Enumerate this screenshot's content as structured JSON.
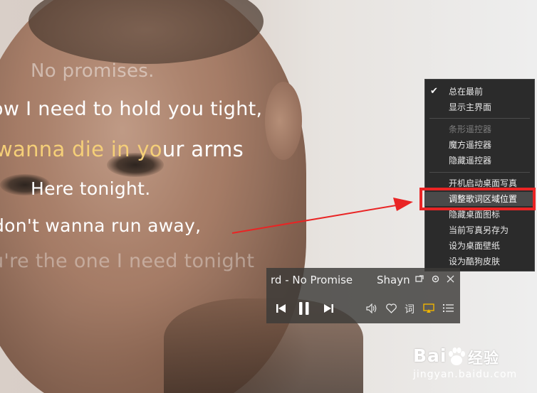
{
  "lyrics": {
    "line1": "No promises.",
    "line2": "ow I need to hold you tight,",
    "line3_sung": "wanna die in yo",
    "line3_rest": "ur arms",
    "line4": "Here tonight.",
    "line5": "don't wanna run away,",
    "line6": "u're the one I need tonight"
  },
  "menu": {
    "items": [
      {
        "label": "总在最前",
        "checked": true
      },
      {
        "label": "显示主界面"
      },
      {
        "label": "条形遥控器",
        "disabled": true
      },
      {
        "label": "魔方遥控器"
      },
      {
        "label": "隐藏遥控器"
      },
      {
        "label": "开机启动桌面写真"
      },
      {
        "label": "调整歌词区域位置",
        "highlighted": true
      },
      {
        "label": "隐藏桌面图标"
      },
      {
        "label": "当前写真另存为"
      },
      {
        "label": "设为桌面壁纸"
      },
      {
        "label": "设为酷狗皮肤"
      }
    ]
  },
  "player": {
    "title": "rd - No Promise",
    "artist": "Shayn",
    "lyric_button": "词",
    "icons": [
      "pin-icon",
      "settings-icon",
      "close-icon",
      "previous-icon",
      "pause-icon",
      "next-icon",
      "volume-icon",
      "favorite-icon",
      "lyrics-icon",
      "desktop-lyrics-icon",
      "playlist-icon"
    ]
  },
  "watermark": {
    "logo": "Bai",
    "logo_tail": "经验",
    "url": "jingyan.baidu.com"
  },
  "colors": {
    "lyric_sung": "#f5cf78",
    "menu_bg": "#2b2b2b",
    "highlight_box": "#e92424",
    "accent": "#f0b400"
  }
}
